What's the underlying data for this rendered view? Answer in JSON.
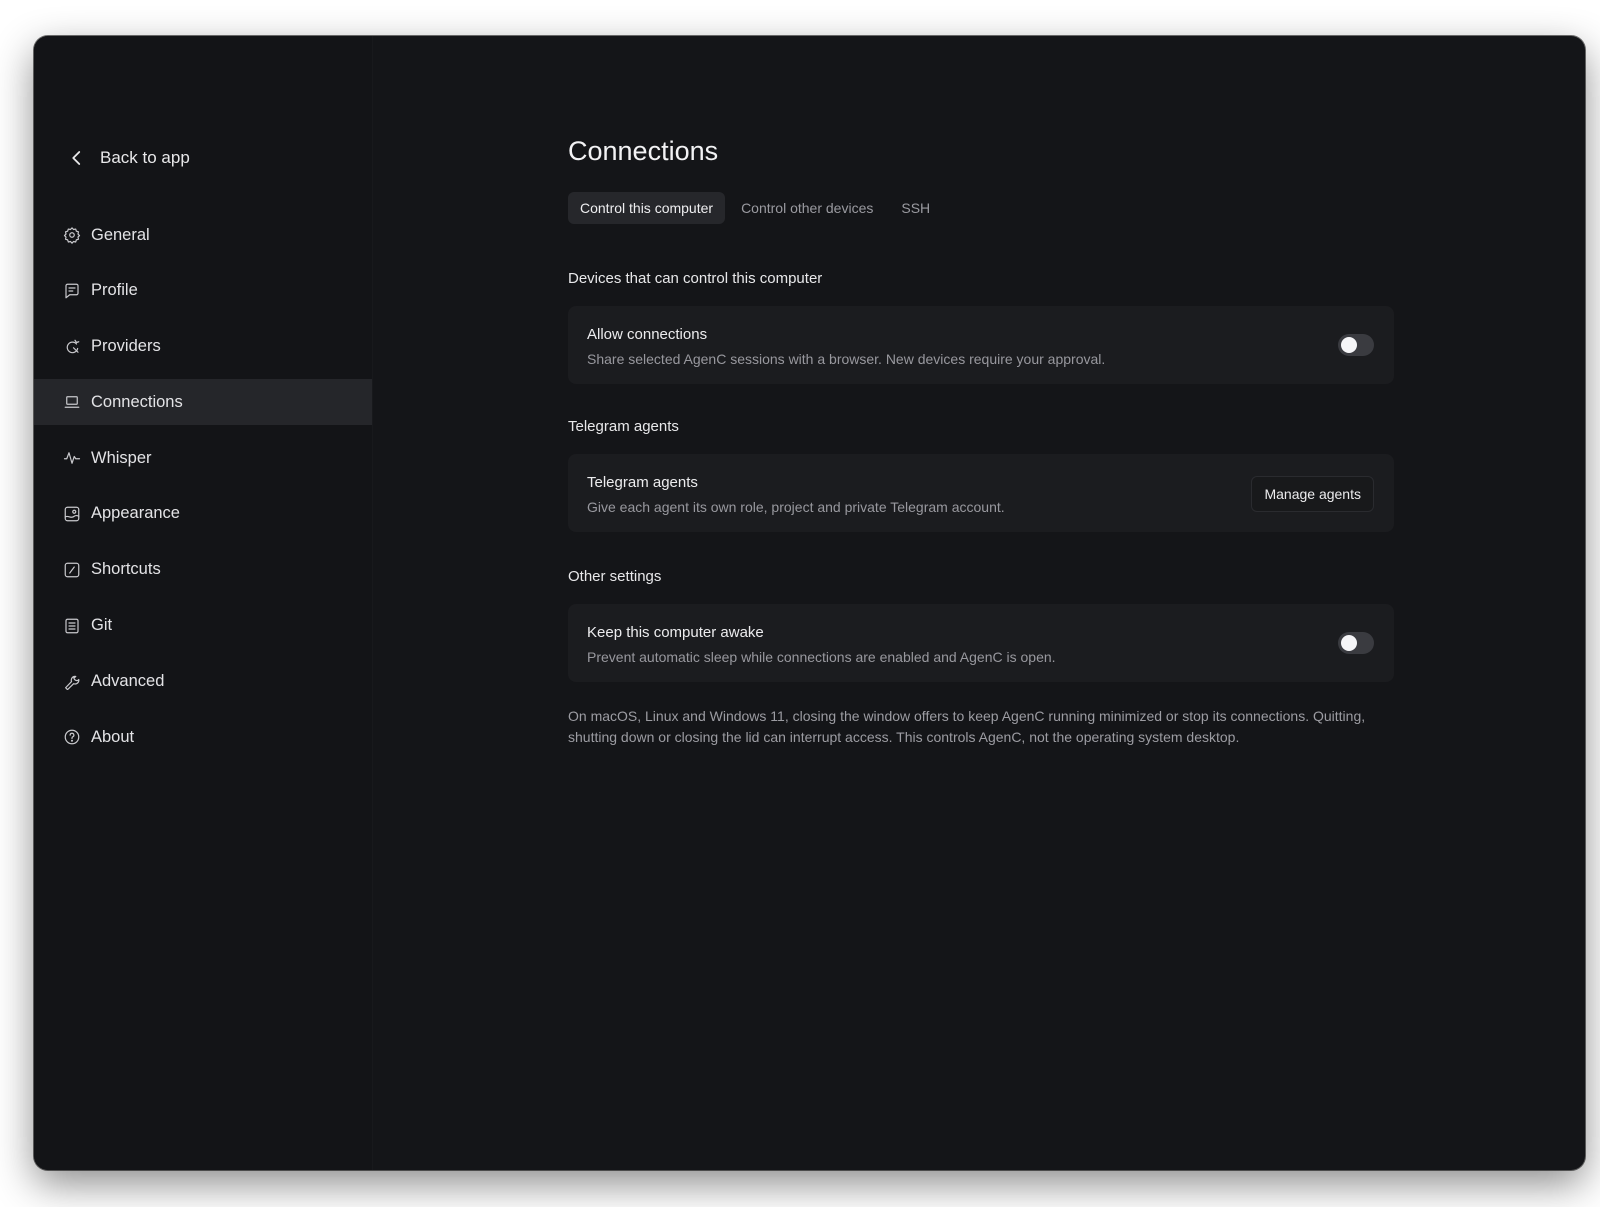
{
  "window": {
    "traffic_lights": [
      {
        "name": "close",
        "color": "#ff5f57"
      },
      {
        "name": "minimize",
        "color": "#febc2e"
      },
      {
        "name": "maximize",
        "color": "#28c840"
      }
    ]
  },
  "sidebar": {
    "back_label": "Back to app",
    "back_icon": "chevron-left-icon",
    "items": [
      {
        "label": "General",
        "icon": "gear-icon",
        "active": false
      },
      {
        "label": "Profile",
        "icon": "profile-icon",
        "active": false
      },
      {
        "label": "Providers",
        "icon": "providers-icon",
        "active": false
      },
      {
        "label": "Connections",
        "icon": "laptop-icon",
        "active": true
      },
      {
        "label": "Whisper",
        "icon": "waveform-icon",
        "active": false
      },
      {
        "label": "Appearance",
        "icon": "appearance-icon",
        "active": false
      },
      {
        "label": "Shortcuts",
        "icon": "shortcut-icon",
        "active": false
      },
      {
        "label": "Git",
        "icon": "git-icon",
        "active": false
      },
      {
        "label": "Advanced",
        "icon": "wrench-icon",
        "active": false
      },
      {
        "label": "About",
        "icon": "help-circle-icon",
        "active": false
      }
    ]
  },
  "main": {
    "title": "Connections",
    "tabs": [
      {
        "label": "Control this computer",
        "active": true
      },
      {
        "label": "Control other devices",
        "active": false
      },
      {
        "label": "SSH",
        "active": false
      }
    ],
    "sections": {
      "devices": {
        "title": "Devices that can control this computer",
        "card": {
          "title": "Allow connections",
          "description": "Share selected AgenC sessions with a browser. New devices require your approval.",
          "toggle_on": false
        }
      },
      "telegram": {
        "title": "Telegram agents",
        "card": {
          "title": "Telegram agents",
          "description": "Give each agent its own role, project and private Telegram account.",
          "button_label": "Manage agents"
        }
      },
      "other": {
        "title": "Other settings",
        "card": {
          "title": "Keep this computer awake",
          "description": "Prevent automatic sleep while connections are enabled and AgenC is open.",
          "toggle_on": false
        }
      }
    },
    "footnote": "On macOS, Linux and Windows 11, closing the window offers to keep AgenC running minimized or stop its connections. Quitting, shutting down or closing the lid can interrupt access. This controls AgenC, not the operating system desktop."
  }
}
